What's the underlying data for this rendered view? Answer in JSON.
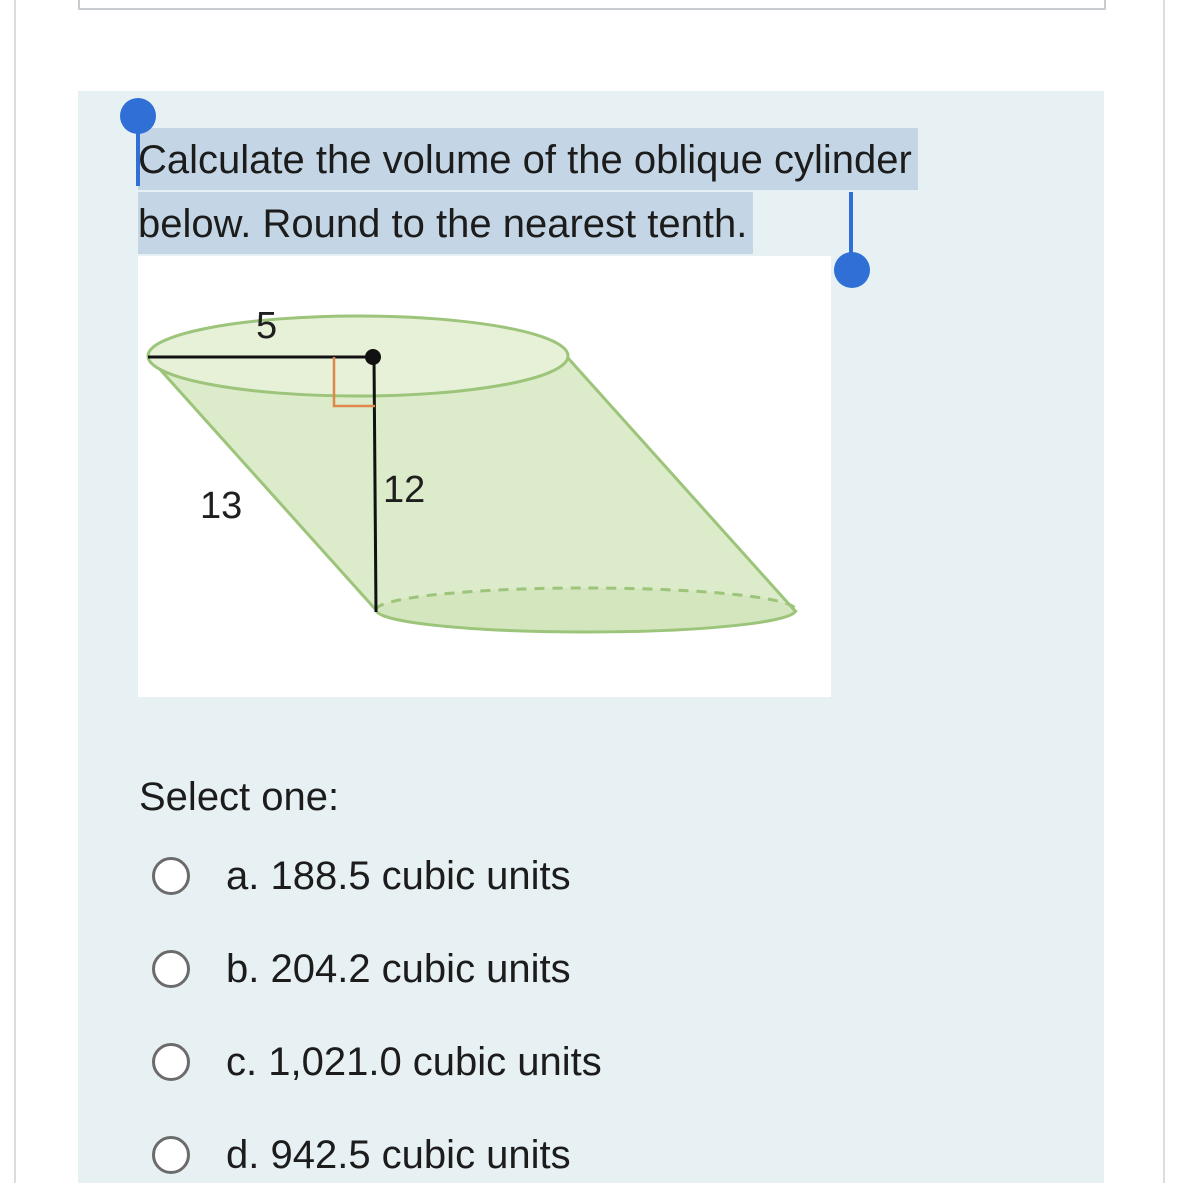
{
  "question": {
    "line1": "Calculate the volume of the oblique cylinder",
    "line2": "below. Round to the nearest tenth."
  },
  "figure": {
    "radius_label": "5",
    "slant_label": "13",
    "height_label": "12"
  },
  "answer": {
    "prompt": "Select one:",
    "options": [
      {
        "label": "a. 188.5 cubic units"
      },
      {
        "label": "b. 204.2 cubic units"
      },
      {
        "label": "c. 1,021.0 cubic units"
      },
      {
        "label": "d. 942.5 cubic units"
      }
    ]
  },
  "colors": {
    "panel_bg": "#e7f0f3",
    "selection": "#c4d6e5",
    "selection_handle": "#2f6fd6",
    "cylinder_fill": "#dcebc9",
    "cylinder_stroke": "#9cc47a"
  }
}
